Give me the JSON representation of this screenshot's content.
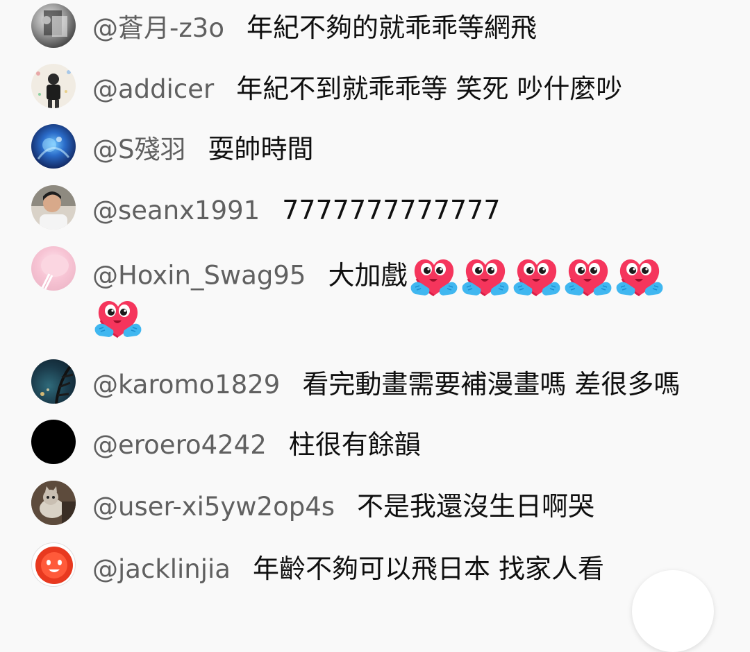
{
  "comments": [
    {
      "user": "@蒼月-z3o",
      "text": "年紀不夠的就乖乖等網飛",
      "avatar": "avatar-photo-dark"
    },
    {
      "user": "@addicer",
      "text": "年紀不到就乖乖等 笑死 吵什麼吵",
      "avatar": "avatar-person-photo"
    },
    {
      "user": "@S殘羽",
      "text": "耍帥時間",
      "avatar": "avatar-blue-art"
    },
    {
      "user": "@seanx1991",
      "text": "7777777777777",
      "avatar": "avatar-person-photo"
    },
    {
      "user": "@Hoxin_Swag95",
      "text": "大加戲",
      "avatar": "avatar-pink-food",
      "emoji": "heart-hug-emoji",
      "emoji_count": 6
    },
    {
      "user": "@karomo1829",
      "text": "看完動畫需要補漫畫嗎 差很多嗎",
      "avatar": "avatar-night-art"
    },
    {
      "user": "@eroero4242",
      "text": "柱很有餘韻",
      "avatar": "avatar-black"
    },
    {
      "user": "@user-xi5yw2op4s",
      "text": "不是我還沒生日啊哭",
      "avatar": "avatar-cat-photo"
    },
    {
      "user": "@jacklinjia",
      "text": "年齡不夠可以飛日本 找家人看",
      "avatar": "avatar-red-drum"
    }
  ],
  "colors": {
    "username": "#606060",
    "message": "#0f0f0f",
    "background": "#f9f9f9"
  }
}
